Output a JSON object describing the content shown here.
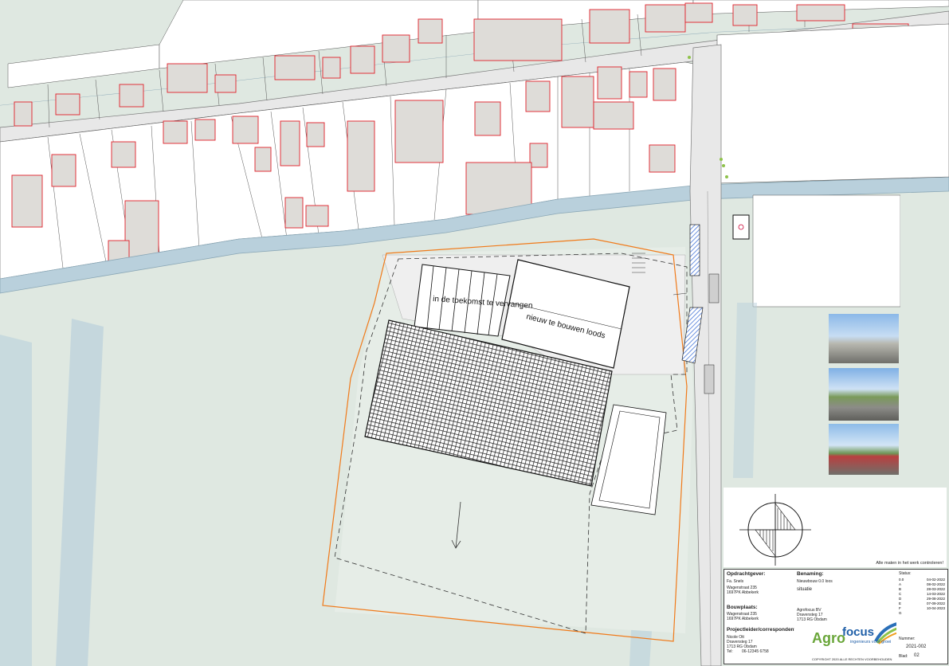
{
  "labels": {
    "future_replace": "in de toekomst te vervangen",
    "new_build": "nieuw te bouwen loods",
    "verify_note": "Alle maten in het werk controleren!"
  },
  "titleblock": {
    "client_heading": "Opdrachtgever:",
    "client_lines": [
      "Fa. Snels",
      "Wagenstraat 235",
      "1697PK Abbekerk"
    ],
    "site_heading": "Bouwplaats:",
    "site_lines": [
      "Wagenstraat 235",
      "1697PK Abbekerk"
    ],
    "lead_heading": "Projectleider/correspondentie:",
    "lead_lines": [
      "Nicole Ott",
      "Dravensteg 17",
      "1713 RG Obdam",
      "Tel:",
      "06-12345 6758"
    ],
    "name_heading": "Benaming:",
    "name_value": "Nieuwbouw 0.0 loos",
    "drawing_title": "situatie",
    "firm_lines": [
      "Agrofocus BV",
      "Dravensteg 17",
      "1713 RG Obdam"
    ],
    "copyright": "COPYRIGHT 2020 ALLE RECHTEN VOORBEHOUDEN",
    "logo_agro": "Agro",
    "logo_focus": "focus",
    "tagline": "ingenieurs voor groei",
    "status_label": "Status:",
    "number_label": "Nummer:",
    "number_value": "2021-002",
    "blad_label": "Blad:",
    "blad_value": "02",
    "revisions": [
      {
        "rev": "0.0",
        "date": "04-02-2022"
      },
      {
        "rev": "A",
        "date": "08-02-2022"
      },
      {
        "rev": "B",
        "date": "28-03-2022"
      },
      {
        "rev": "C",
        "date": "14-03-2022"
      },
      {
        "rev": "D",
        "date": "29-08-2022"
      },
      {
        "rev": "E",
        "date": "07-09-2022"
      },
      {
        "rev": "F",
        "date": "10-04-2023"
      },
      {
        "rev": "G",
        "date": ""
      }
    ]
  },
  "colors": {
    "plot_boundary": "#f07a1a",
    "building_outline": "#e0202a",
    "water": "#b9d0dc",
    "grass": "#dfe8e1",
    "building_fill": "#dedcd8",
    "solar": "#222222"
  }
}
